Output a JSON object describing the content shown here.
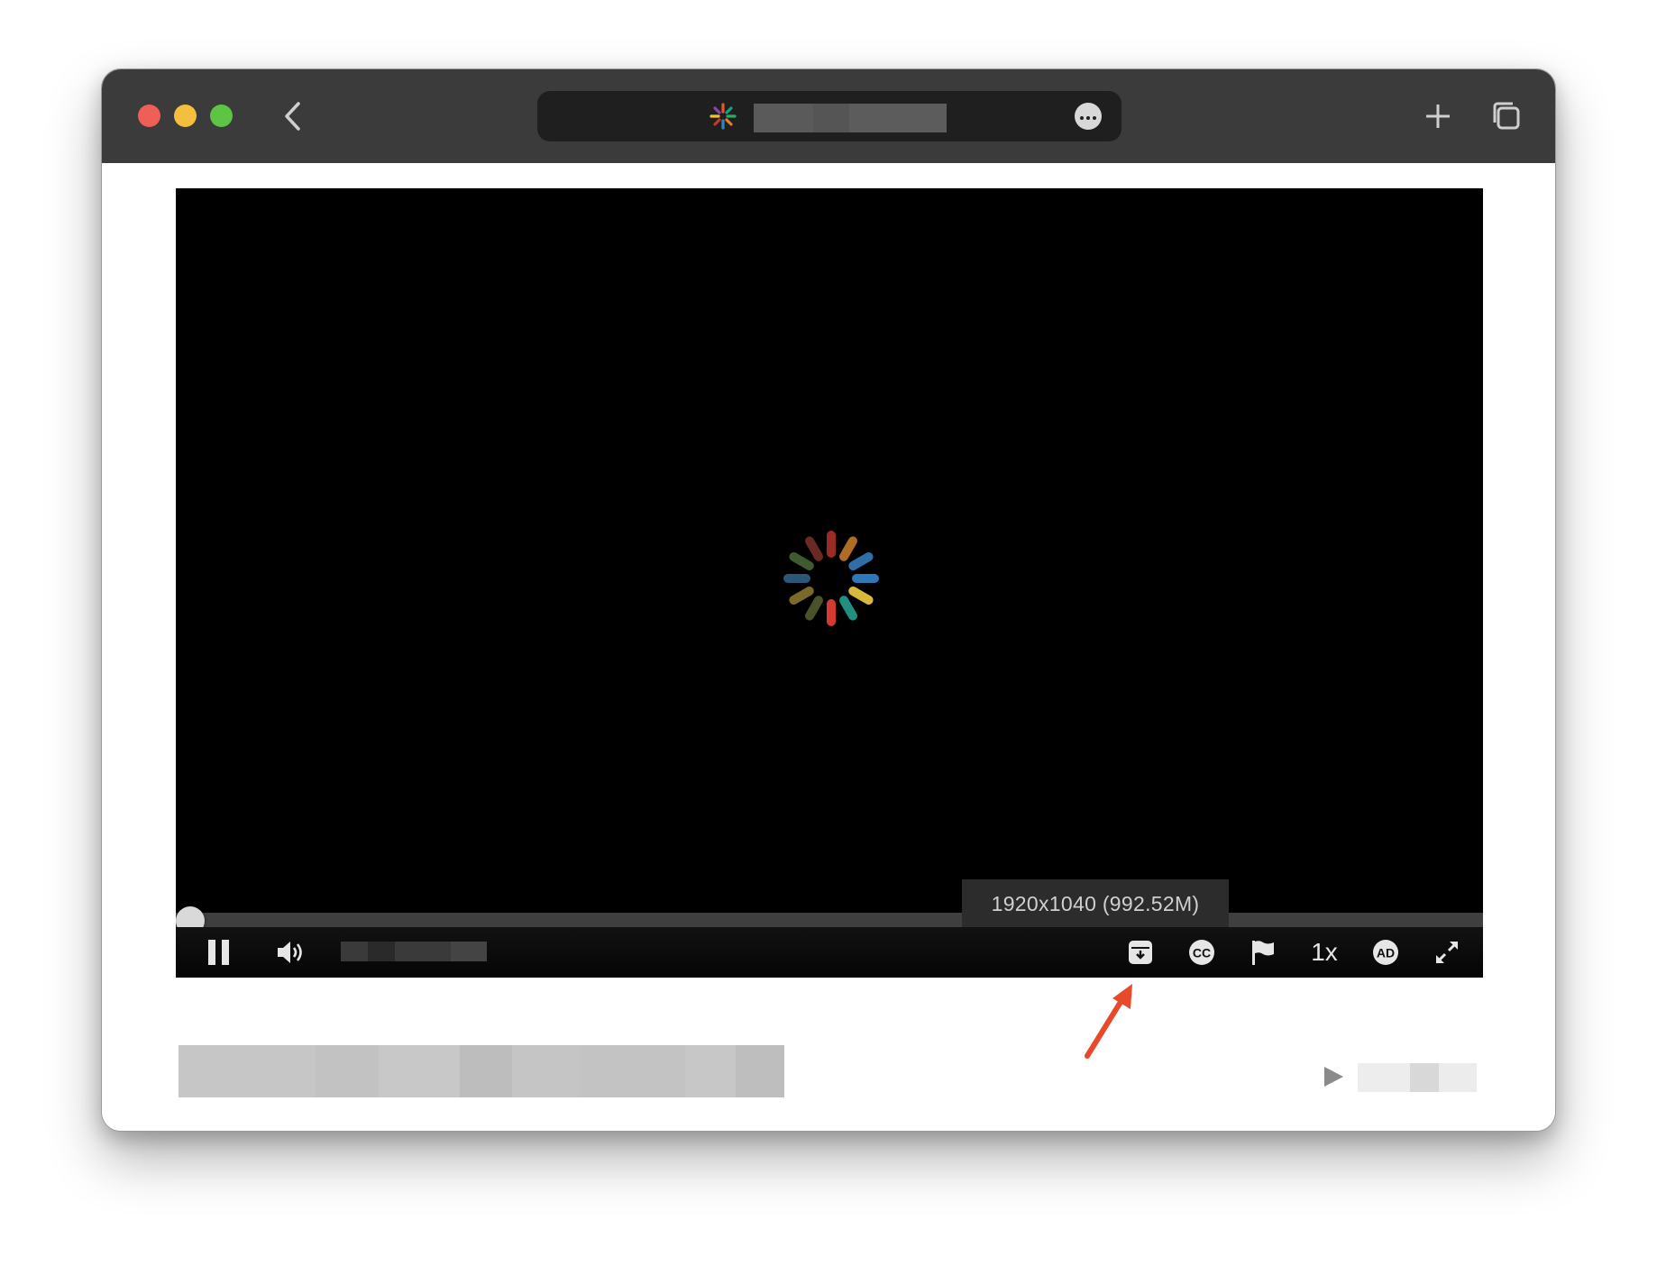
{
  "browser": {
    "back_icon": "chevron-left-icon",
    "favicon": "colorful-sparkle-icon",
    "more_icon": "ellipsis-circle-icon",
    "new_tab_icon": "plus-icon",
    "tabs_icon": "tab-overview-icon"
  },
  "player": {
    "state": "loading",
    "spinner_icon": "loading-spinner-icon",
    "progress_fraction": 0.0,
    "tooltip_text": "1920x1040 (992.52M)",
    "controls": {
      "pause_icon": "pause-icon",
      "volume_icon": "volume-icon",
      "download_icon": "download-icon",
      "cc_icon": "closed-captions-icon",
      "flag_icon": "flag-icon",
      "playback_rate": "1x",
      "ad_icon": "audio-description-icon",
      "fullscreen_icon": "fullscreen-icon"
    }
  },
  "below_player": {
    "play_icon": "play-icon"
  },
  "annotation": {
    "arrow_color": "#e8492b",
    "points_to": "download-button"
  },
  "colors": {
    "titlebar": "#3b3b3b",
    "address_bar": "#1f1f1f",
    "player_bg": "#000000",
    "progress_track": "#3f3f3f"
  }
}
